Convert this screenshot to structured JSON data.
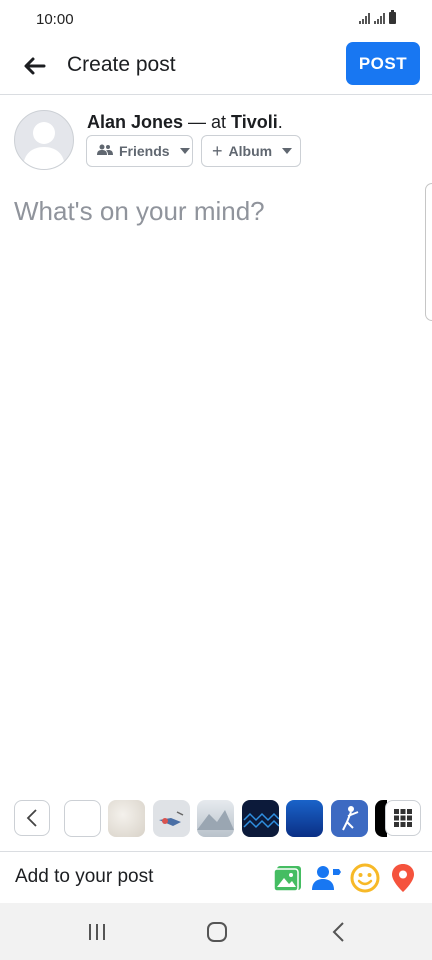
{
  "status_bar": {
    "time": "10:00",
    "icons": [
      "signal-icon",
      "signal-icon",
      "battery-icon"
    ]
  },
  "header": {
    "title": "Create post",
    "post_label": "POST",
    "back_icon": "back-arrow-icon"
  },
  "author": {
    "name": "Alan Jones",
    "separator": " — at ",
    "place": "Tivoli",
    "suffix": "."
  },
  "audience": {
    "friends_label": "Friends",
    "album_label": "Album"
  },
  "composer": {
    "placeholder": "What's on your mind?"
  },
  "backgrounds": {
    "swatches": [
      "white",
      "cotton",
      "illustration",
      "mountain",
      "dark-blue-pattern",
      "blue-gradient",
      "figure-blue",
      "black-white"
    ]
  },
  "add_to_post": {
    "label": "Add to your post",
    "icons": [
      "photo-icon",
      "tag-people-icon",
      "feeling-icon",
      "check-in-icon"
    ],
    "colors": {
      "photo": "#45bd62",
      "tag": "#1877f2",
      "feeling": "#f7b928",
      "checkin": "#f5533d"
    }
  },
  "colors": {
    "accent": "#1877f2"
  },
  "nav": [
    "recent-apps-icon",
    "home-icon",
    "back-icon"
  ]
}
